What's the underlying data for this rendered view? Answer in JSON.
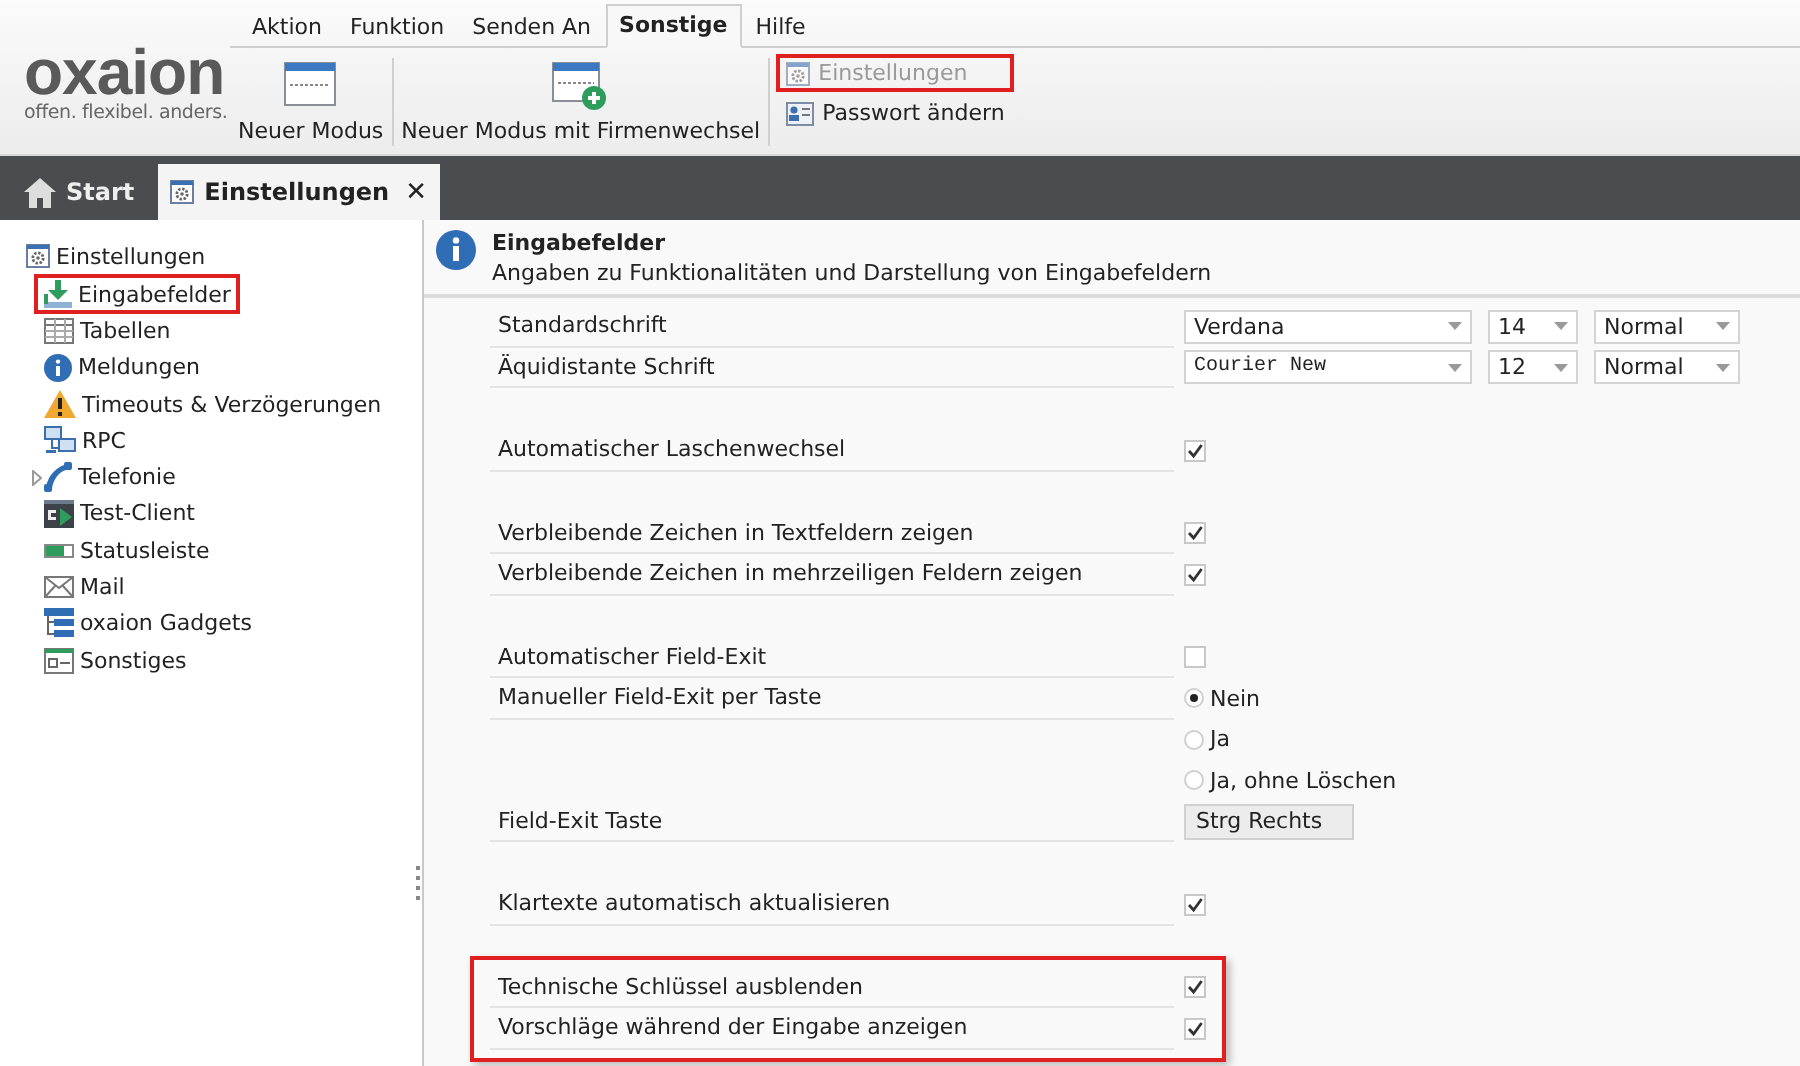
{
  "menu": [
    {
      "label": "Aktion",
      "selected": false
    },
    {
      "label": "Funktion",
      "selected": false
    },
    {
      "label": "Senden An",
      "selected": false
    },
    {
      "label": "Sonstige",
      "selected": true
    },
    {
      "label": "Hilfe",
      "selected": false
    }
  ],
  "logo": {
    "name": "oxaion",
    "tagline": "offen. flexibel. anders."
  },
  "ribbon": {
    "large_buttons": [
      {
        "label": "Neuer Modus",
        "kind": "window"
      },
      {
        "label": "Neuer Modus mit Firmenwechsel",
        "kind": "window-add"
      }
    ],
    "small_buttons": [
      {
        "label": "Einstellungen",
        "kind": "gear",
        "disabled": true,
        "highlighted": true
      },
      {
        "label": "Passwort ändern",
        "kind": "card",
        "disabled": false,
        "highlighted": false
      }
    ]
  },
  "tabs": [
    {
      "label": "Start",
      "kind": "home",
      "selected": false
    },
    {
      "label": "Einstellungen",
      "kind": "gear",
      "selected": true,
      "close": "✕"
    }
  ],
  "tree": {
    "label": "Einstellungen",
    "kind": "gear",
    "children": [
      {
        "label": "Eingabefelder",
        "kind": "input",
        "highlighted": true
      },
      {
        "label": "Tabellen",
        "kind": "table",
        "highlighted": false
      },
      {
        "label": "Meldungen",
        "kind": "info",
        "highlighted": false
      },
      {
        "label": "Timeouts & Verzögerungen",
        "kind": "warning",
        "highlighted": false
      },
      {
        "label": "RPC",
        "kind": "network",
        "highlighted": false
      },
      {
        "label": "Telefonie",
        "kind": "phone",
        "highlighted": false,
        "expanded": false
      },
      {
        "label": "Test-Client",
        "kind": "terminal",
        "highlighted": false
      },
      {
        "label": "Statusleiste",
        "kind": "statusbar",
        "highlighted": false
      },
      {
        "label": "Mail",
        "kind": "mail",
        "highlighted": false
      },
      {
        "label": "oxaion Gadgets",
        "kind": "gadgets",
        "highlighted": false
      },
      {
        "label": "Sonstiges",
        "kind": "form",
        "highlighted": false
      }
    ]
  },
  "header": {
    "title": "Eingabefelder",
    "subtitle": "Angaben zu Funktionalitäten und Darstellung von Eingabefeldern"
  },
  "groups": [
    {
      "highlighted": false,
      "rows": [
        {
          "kind": "font",
          "label": "Standardschrift",
          "family": "Verdana",
          "monospace": false,
          "size": "14",
          "style": "Normal"
        },
        {
          "kind": "font",
          "label": "Äquidistante Schrift",
          "family": "Courier New",
          "monospace": true,
          "size": "12",
          "style": "Normal"
        }
      ]
    },
    {
      "highlighted": false,
      "rows": [
        {
          "kind": "checkbox",
          "label": "Automatischer Laschenwechsel",
          "checked": true
        }
      ]
    },
    {
      "highlighted": false,
      "rows": [
        {
          "kind": "checkbox",
          "label": "Verbleibende Zeichen in Textfeldern zeigen",
          "checked": true
        },
        {
          "kind": "checkbox",
          "label": "Verbleibende Zeichen in mehrzeiligen Feldern zeigen",
          "checked": true
        }
      ]
    },
    {
      "highlighted": false,
      "rows": [
        {
          "kind": "checkbox",
          "label": "Automatischer Field-Exit",
          "checked": false
        },
        {
          "kind": "radio",
          "label": "Manueller Field-Exit per Taste",
          "options": [
            {
              "label": "Nein",
              "selected": true
            },
            {
              "label": "Ja",
              "selected": false
            },
            {
              "label": "Ja, ohne Löschen",
              "selected": false
            }
          ]
        },
        {
          "kind": "value",
          "label": "Field-Exit Taste",
          "value": "Strg Rechts"
        }
      ]
    },
    {
      "highlighted": false,
      "rows": [
        {
          "kind": "checkbox",
          "label": "Klartexte automatisch aktualisieren",
          "checked": true
        }
      ]
    },
    {
      "highlighted": true,
      "rows": [
        {
          "kind": "checkbox",
          "label": "Technische Schlüssel ausblenden",
          "checked": true
        },
        {
          "kind": "checkbox",
          "label": "Vorschläge während der Eingabe anzeigen",
          "checked": true
        }
      ]
    }
  ]
}
